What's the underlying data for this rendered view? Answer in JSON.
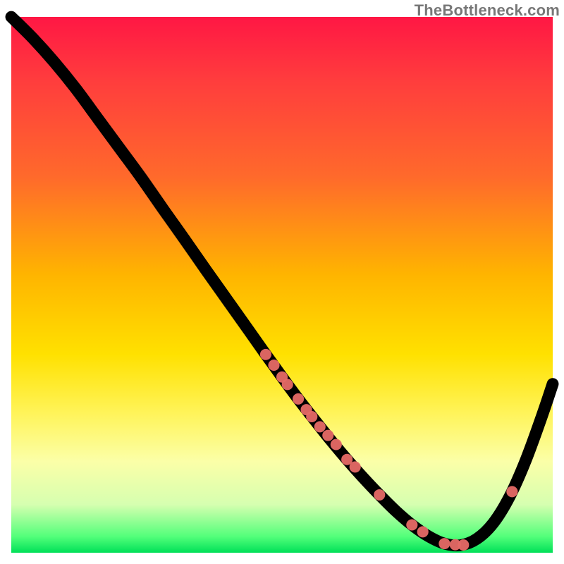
{
  "watermark": "TheBottleneck.com",
  "chart_data": {
    "type": "line",
    "title": "",
    "xlabel": "",
    "ylabel": "",
    "xlim": [
      0,
      100
    ],
    "ylim": [
      0,
      100
    ],
    "grid": false,
    "series": [
      {
        "name": "curve",
        "x": [
          0,
          4,
          8,
          12,
          16,
          20,
          24,
          28,
          32,
          36,
          40,
          44,
          47,
          50,
          53,
          56,
          59,
          62,
          65,
          68,
          71,
          74,
          77,
          80,
          83,
          86,
          89,
          92,
          95,
          98,
          100
        ],
        "y": [
          100,
          96,
          91.5,
          86.5,
          81,
          75.5,
          70,
          64.2,
          58.5,
          52.7,
          47,
          41.3,
          37,
          32.8,
          28.7,
          24.8,
          21,
          17.4,
          14,
          10.8,
          7.8,
          5.2,
          3.1,
          1.7,
          1.4,
          2.6,
          5.5,
          10.4,
          17.2,
          25.5,
          31.5
        ]
      }
    ],
    "points": {
      "name": "markers",
      "x": [
        47,
        48.5,
        50,
        51,
        53,
        54.5,
        55.5,
        57,
        58.5,
        60,
        62,
        63.5,
        68,
        74,
        76,
        80,
        82,
        83.5,
        92.5
      ],
      "y": [
        37,
        35,
        32.8,
        31.4,
        28.7,
        26.7,
        25.4,
        23.5,
        21.9,
        20.2,
        17.4,
        16,
        10.8,
        5.2,
        3.9,
        1.7,
        1.5,
        1.45,
        11.4
      ]
    },
    "gradient_stops": [
      {
        "pos": 0,
        "color": "#ff1744"
      },
      {
        "pos": 30,
        "color": "#ff6a2b"
      },
      {
        "pos": 60,
        "color": "#ffe100"
      },
      {
        "pos": 85,
        "color": "#fbffa8"
      },
      {
        "pos": 100,
        "color": "#00e058"
      }
    ]
  }
}
